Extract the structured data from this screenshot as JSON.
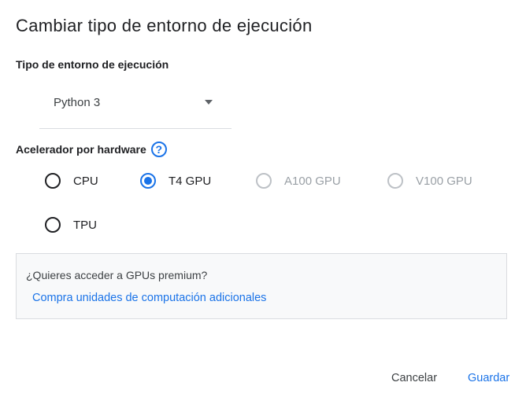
{
  "dialog": {
    "title": "Cambiar tipo de entorno de ejecución",
    "runtime_section_label": "Tipo de entorno de ejecución",
    "runtime_select": {
      "value": "Python 3"
    },
    "accelerator_section_label": "Acelerador por hardware",
    "help_glyph": "?",
    "accelerators": [
      {
        "label": "CPU",
        "checked": false,
        "disabled": false
      },
      {
        "label": "T4 GPU",
        "checked": true,
        "disabled": false
      },
      {
        "label": "A100 GPU",
        "checked": false,
        "disabled": true
      },
      {
        "label": "V100 GPU",
        "checked": false,
        "disabled": true
      },
      {
        "label": "TPU",
        "checked": false,
        "disabled": false
      }
    ],
    "premium": {
      "question": "¿Quieres acceder a GPUs premium?",
      "link": "Compra unidades de computación adicionales"
    },
    "buttons": {
      "cancel": "Cancelar",
      "save": "Guardar"
    }
  },
  "colors": {
    "accent": "#1a73e8",
    "text": "#202124",
    "disabled": "#9aa0a6",
    "panel_bg": "#f8f9fa"
  }
}
